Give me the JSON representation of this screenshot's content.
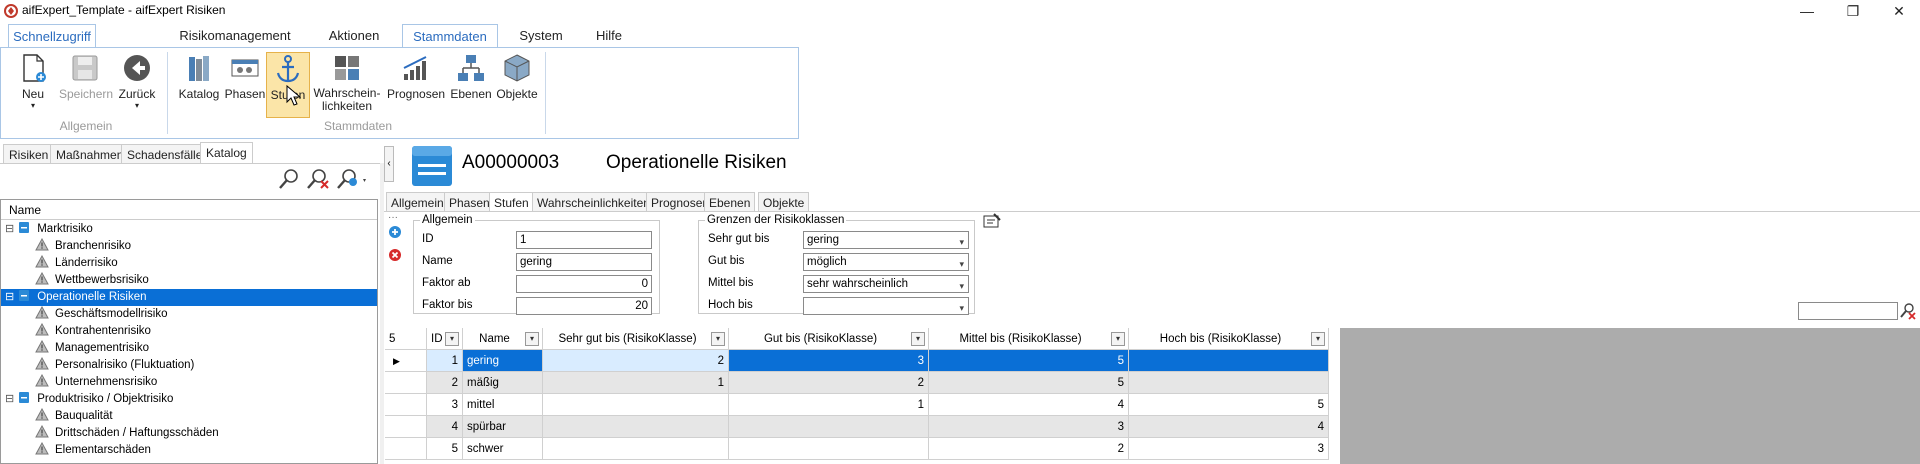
{
  "window": {
    "title": "aifExpert_Template - aifExpert Risiken",
    "minimize_glyph": "—",
    "maximize_glyph": "❐",
    "close_glyph": "✕"
  },
  "ribbon": {
    "tabs": [
      "Schnellzugriff",
      "Risikomanagement",
      "Aktionen",
      "Stammdaten",
      "System",
      "Hilfe"
    ],
    "active_tab": "Stammdaten",
    "groups": [
      {
        "label": "Allgemein",
        "buttons": [
          "Neu",
          "Speichern",
          "Zurück"
        ]
      },
      {
        "label": "Stammdaten",
        "buttons": [
          "Katalog",
          "Phasen",
          "Stufen",
          "Wahrschein-\nlichkeiten",
          "Prognosen",
          "Ebenen",
          "Objekte"
        ]
      }
    ],
    "selected_button": "Stufen"
  },
  "left": {
    "tabs": [
      "Risiken",
      "Maßnahmen",
      "Schadensfälle",
      "Katalog"
    ],
    "active_tab": "Katalog",
    "tree_header": "Name",
    "tree": [
      {
        "label": "Marktrisiko",
        "level": 0,
        "kind": "db",
        "expand": "⊟"
      },
      {
        "label": "Branchenrisiko",
        "level": 1,
        "kind": "warn"
      },
      {
        "label": "Länderrisiko",
        "level": 1,
        "kind": "warn"
      },
      {
        "label": "Wettbewerbsrisiko",
        "level": 1,
        "kind": "warn"
      },
      {
        "label": "Operationelle Risiken",
        "level": 0,
        "kind": "db",
        "expand": "⊟",
        "selected": true
      },
      {
        "label": "Geschäftsmodellrisiko",
        "level": 1,
        "kind": "warn"
      },
      {
        "label": "Kontrahentenrisiko",
        "level": 1,
        "kind": "warn"
      },
      {
        "label": "Managementrisiko",
        "level": 1,
        "kind": "warn"
      },
      {
        "label": "Personalrisiko (Fluktuation)",
        "level": 1,
        "kind": "warn"
      },
      {
        "label": "Unternehmensrisiko",
        "level": 1,
        "kind": "warn"
      },
      {
        "label": "Produktrisiko / Objektrisiko",
        "level": 0,
        "kind": "db",
        "expand": "⊟"
      },
      {
        "label": "Bauqualität",
        "level": 1,
        "kind": "warn"
      },
      {
        "label": "Drittschäden / Haftungsschäden",
        "level": 1,
        "kind": "warn"
      },
      {
        "label": "Elementarschäden",
        "level": 1,
        "kind": "warn"
      }
    ]
  },
  "detail": {
    "code": "A00000003",
    "name": "Operationelle Risiken",
    "tabs": [
      "Allgemein",
      "Phasen",
      "Stufen",
      "Wahrscheinlichkeiten",
      "Prognosen",
      "Ebenen",
      "Objekte"
    ],
    "active_tab": "Stufen",
    "allgemein": {
      "legend": "Allgemein",
      "id_label": "ID",
      "id_value": "1",
      "name_label": "Name",
      "name_value": "gering",
      "faktor_ab_label": "Faktor ab",
      "faktor_ab_value": "0",
      "faktor_bis_label": "Faktor bis",
      "faktor_bis_value": "20"
    },
    "grenzen": {
      "legend": "Grenzen der Risikoklassen",
      "sehr_gut_label": "Sehr gut bis",
      "sehr_gut_value": "gering",
      "gut_label": "Gut bis",
      "gut_value": "möglich",
      "mittel_label": "Mittel bis",
      "mittel_value": "sehr wahrscheinlich",
      "hoch_label": "Hoch bis",
      "hoch_value": ""
    }
  },
  "grid": {
    "row_count": "5",
    "columns": [
      "ID",
      "Name",
      "Sehr gut bis (RisikoKlasse)",
      "Gut bis (RisikoKlasse)",
      "Mittel bis (RisikoKlasse)",
      "Hoch bis (RisikoKlasse)"
    ],
    "rows": [
      [
        "1",
        "gering",
        "2",
        "3",
        "5",
        ""
      ],
      [
        "2",
        "mäßig",
        "1",
        "2",
        "5",
        ""
      ],
      [
        "3",
        "mittel",
        "",
        "1",
        "4",
        "5"
      ],
      [
        "4",
        "spürbar",
        "",
        "",
        "3",
        "4"
      ],
      [
        "5",
        "schwer",
        "",
        "",
        "2",
        "3"
      ]
    ],
    "selected_row": 0,
    "current_row_marker": "▶"
  }
}
